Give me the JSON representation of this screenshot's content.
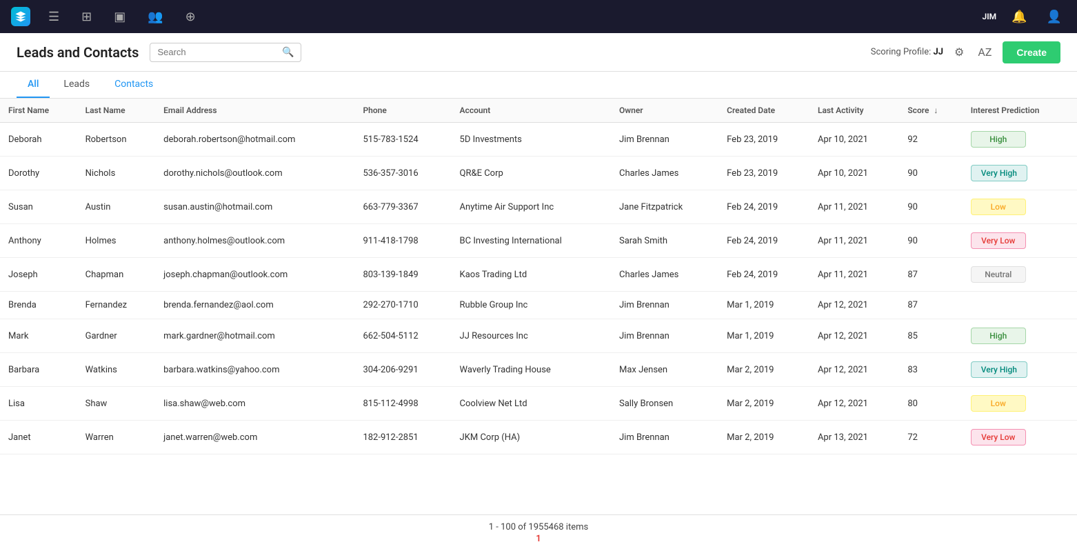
{
  "nav": {
    "user": "JIM"
  },
  "header": {
    "title": "Leads and Contacts",
    "search_placeholder": "Search",
    "scoring_label": "Scoring Profile:",
    "scoring_value": "JJ",
    "create_button": "Create"
  },
  "tabs": [
    {
      "id": "all",
      "label": "All",
      "active": true
    },
    {
      "id": "leads",
      "label": "Leads",
      "active": false
    },
    {
      "id": "contacts",
      "label": "Contacts",
      "active": false
    }
  ],
  "table": {
    "columns": [
      {
        "id": "first_name",
        "label": "First Name"
      },
      {
        "id": "last_name",
        "label": "Last Name"
      },
      {
        "id": "email",
        "label": "Email Address"
      },
      {
        "id": "phone",
        "label": "Phone"
      },
      {
        "id": "account",
        "label": "Account"
      },
      {
        "id": "owner",
        "label": "Owner"
      },
      {
        "id": "created_date",
        "label": "Created Date"
      },
      {
        "id": "last_activity",
        "label": "Last Activity"
      },
      {
        "id": "score",
        "label": "Score",
        "sortable": true,
        "sort_dir": "desc"
      },
      {
        "id": "interest",
        "label": "Interest Prediction"
      }
    ],
    "rows": [
      {
        "first": "Deborah",
        "last": "Robertson",
        "email": "deborah.robertson@hotmail.com",
        "phone": "515-783-1524",
        "account": "5D Investments",
        "owner": "Jim Brennan",
        "created": "Feb 23, 2019",
        "last_activity": "Apr 10, 2021",
        "score": "92",
        "interest": "High",
        "interest_type": "high"
      },
      {
        "first": "Dorothy",
        "last": "Nichols",
        "email": "dorothy.nichols@outlook.com",
        "phone": "536-357-3016",
        "account": "QR&E Corp",
        "owner": "Charles James",
        "created": "Feb 23, 2019",
        "last_activity": "Apr 10, 2021",
        "score": "90",
        "interest": "Very High",
        "interest_type": "very-high"
      },
      {
        "first": "Susan",
        "last": "Austin",
        "email": "susan.austin@hotmail.com",
        "phone": "663-779-3367",
        "account": "Anytime Air Support Inc",
        "owner": "Jane Fitzpatrick",
        "created": "Feb 24, 2019",
        "last_activity": "Apr 11, 2021",
        "score": "90",
        "interest": "Low",
        "interest_type": "low"
      },
      {
        "first": "Anthony",
        "last": "Holmes",
        "email": "anthony.holmes@outlook.com",
        "phone": "911-418-1798",
        "account": "BC Investing International",
        "owner": "Sarah Smith",
        "created": "Feb 24, 2019",
        "last_activity": "Apr 11, 2021",
        "score": "90",
        "interest": "Very Low",
        "interest_type": "very-low"
      },
      {
        "first": "Joseph",
        "last": "Chapman",
        "email": "joseph.chapman@outlook.com",
        "phone": "803-139-1849",
        "account": "Kaos Trading Ltd",
        "owner": "Charles James",
        "created": "Feb 24, 2019",
        "last_activity": "Apr 11, 2021",
        "score": "87",
        "interest": "Neutral",
        "interest_type": "neutral"
      },
      {
        "first": "Brenda",
        "last": "Fernandez",
        "email": "brenda.fernandez@aol.com",
        "phone": "292-270-1710",
        "account": "Rubble Group Inc",
        "owner": "Jim Brennan",
        "created": "Mar 1, 2019",
        "last_activity": "Apr 12, 2021",
        "score": "87",
        "interest": "",
        "interest_type": "empty"
      },
      {
        "first": "Mark",
        "last": "Gardner",
        "email": "mark.gardner@hotmail.com",
        "phone": "662-504-5112",
        "account": "JJ Resources Inc",
        "owner": "Jim Brennan",
        "created": "Mar 1, 2019",
        "last_activity": "Apr 12, 2021",
        "score": "85",
        "interest": "High",
        "interest_type": "high"
      },
      {
        "first": "Barbara",
        "last": "Watkins",
        "email": "barbara.watkins@yahoo.com",
        "phone": "304-206-9291",
        "account": "Waverly Trading House",
        "owner": "Max Jensen",
        "created": "Mar 2, 2019",
        "last_activity": "Apr 12, 2021",
        "score": "83",
        "interest": "Very High",
        "interest_type": "very-high"
      },
      {
        "first": "Lisa",
        "last": "Shaw",
        "email": "lisa.shaw@web.com",
        "phone": "815-112-4998",
        "account": "Coolview Net Ltd",
        "owner": "Sally Bronsen",
        "created": "Mar 2, 2019",
        "last_activity": "Apr 12, 2021",
        "score": "80",
        "interest": "Low",
        "interest_type": "low"
      },
      {
        "first": "Janet",
        "last": "Warren",
        "email": "janet.warren@web.com",
        "phone": "182-912-2851",
        "account": "JKM Corp (HA)",
        "owner": "Jim Brennan",
        "created": "Mar 2, 2019",
        "last_activity": "Apr 13, 2021",
        "score": "72",
        "interest": "Very Low",
        "interest_type": "very-low"
      }
    ]
  },
  "footer": {
    "pagination_text": "1 - 100 of 1955468 items",
    "page_number": "1"
  }
}
